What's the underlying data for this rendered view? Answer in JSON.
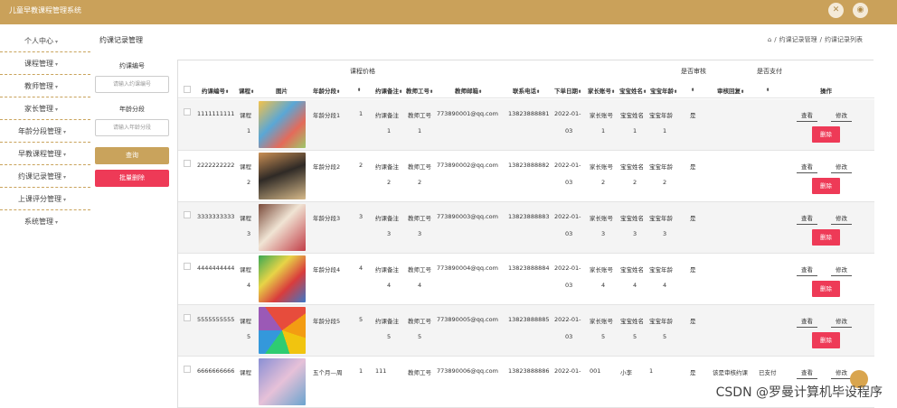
{
  "app": {
    "title": "儿童早教课程管理系统"
  },
  "topbar": {
    "icon1": "close-circle-icon",
    "icon2": "user-icon"
  },
  "sidebar": {
    "items": [
      {
        "label": "个人中心"
      },
      {
        "label": "课程管理"
      },
      {
        "label": "教师管理"
      },
      {
        "label": "家长管理"
      },
      {
        "label": "年龄分段管理"
      },
      {
        "label": "早教课程管理"
      },
      {
        "label": "约课记录管理"
      },
      {
        "label": "上课评分管理"
      },
      {
        "label": "系统管理"
      }
    ]
  },
  "page": {
    "section_title": "约课记录管理",
    "breadcrumb": [
      "约课记录管理",
      "约课记录列表"
    ]
  },
  "filters": {
    "field1_label": "约课编号",
    "field1_placeholder": "请输入约课编号",
    "field2_label": "年龄分段",
    "field2_placeholder": "请输入年龄分段",
    "query_label": "查询",
    "batch_delete_label": "批量删除"
  },
  "table": {
    "group_headers": {
      "course_price": "课程价格",
      "is_reviewed": "是否审核",
      "is_paid": "是否支付"
    },
    "columns": [
      "约课编号",
      "课程",
      "图片",
      "年龄分段",
      "",
      "约课备注",
      "教师工号",
      "教师邮箱",
      "联系电话",
      "下单日期",
      "家长账号",
      "宝宝姓名",
      "宝宝年龄",
      "",
      "审核回复",
      "",
      "操作"
    ],
    "rows": [
      {
        "id": "1111111111",
        "course_a": "课程",
        "course_b": "1",
        "age": "年龄分段1",
        "price": "1",
        "remark_a": "约课备注",
        "remark_b": "1",
        "tid_a": "教师工号",
        "tid_b": "1",
        "email": "773890001@qq.com",
        "phone": "13823888881",
        "date_a": "2022-01-",
        "date_b": "03",
        "parent_a": "家长账号",
        "parent_b": "1",
        "baby_a": "宝宝姓名",
        "baby_b": "1",
        "bage_a": "宝宝年龄",
        "bage_b": "1",
        "reviewed": "是",
        "reply": "",
        "paid": ""
      },
      {
        "id": "2222222222",
        "course_a": "课程",
        "course_b": "2",
        "age": "年龄分段2",
        "price": "2",
        "remark_a": "约课备注",
        "remark_b": "2",
        "tid_a": "教师工号",
        "tid_b": "2",
        "email": "773890002@qq.com",
        "phone": "13823888882",
        "date_a": "2022-01-",
        "date_b": "03",
        "parent_a": "家长账号",
        "parent_b": "2",
        "baby_a": "宝宝姓名",
        "baby_b": "2",
        "bage_a": "宝宝年龄",
        "bage_b": "2",
        "reviewed": "是",
        "reply": "",
        "paid": ""
      },
      {
        "id": "3333333333",
        "course_a": "课程",
        "course_b": "3",
        "age": "年龄分段3",
        "price": "3",
        "remark_a": "约课备注",
        "remark_b": "3",
        "tid_a": "教师工号",
        "tid_b": "3",
        "email": "773890003@qq.com",
        "phone": "13823888883",
        "date_a": "2022-01-",
        "date_b": "03",
        "parent_a": "家长账号",
        "parent_b": "3",
        "baby_a": "宝宝姓名",
        "baby_b": "3",
        "bage_a": "宝宝年龄",
        "bage_b": "3",
        "reviewed": "是",
        "reply": "",
        "paid": ""
      },
      {
        "id": "4444444444",
        "course_a": "课程",
        "course_b": "4",
        "age": "年龄分段4",
        "price": "4",
        "remark_a": "约课备注",
        "remark_b": "4",
        "tid_a": "教师工号",
        "tid_b": "4",
        "email": "773890004@qq.com",
        "phone": "13823888884",
        "date_a": "2022-01-",
        "date_b": "03",
        "parent_a": "家长账号",
        "parent_b": "4",
        "baby_a": "宝宝姓名",
        "baby_b": "4",
        "bage_a": "宝宝年龄",
        "bage_b": "4",
        "reviewed": "是",
        "reply": "",
        "paid": ""
      },
      {
        "id": "5555555555",
        "course_a": "课程",
        "course_b": "5",
        "age": "年龄分段5",
        "price": "5",
        "remark_a": "约课备注",
        "remark_b": "5",
        "tid_a": "教师工号",
        "tid_b": "5",
        "email": "773890005@qq.com",
        "phone": "13823888885",
        "date_a": "2022-01-",
        "date_b": "03",
        "parent_a": "家长账号",
        "parent_b": "5",
        "baby_a": "宝宝姓名",
        "baby_b": "5",
        "bage_a": "宝宝年龄",
        "bage_b": "5",
        "reviewed": "是",
        "reply": "",
        "paid": ""
      },
      {
        "id": "6666666666",
        "course_a": "课程",
        "course_b": "",
        "age": "五个月—周",
        "price": "1",
        "remark_a": "111",
        "remark_b": "",
        "tid_a": "教师工号",
        "tid_b": "",
        "email": "773890006@qq.com",
        "phone": "13823888886",
        "date_a": "2022-01-",
        "date_b": "",
        "parent_a": "001",
        "parent_b": "",
        "baby_a": "小李",
        "baby_b": "",
        "bage_a": "1",
        "bage_b": "",
        "reviewed": "是",
        "reply": "该是审核约课",
        "paid": "已支付"
      }
    ],
    "view_label": "查看",
    "edit_label": "修改",
    "delete_label": "删除"
  },
  "watermark": "CSDN @罗曼计算机毕设程序",
  "colors": {
    "brand": "#caa15a",
    "danger": "#ee3a57"
  }
}
